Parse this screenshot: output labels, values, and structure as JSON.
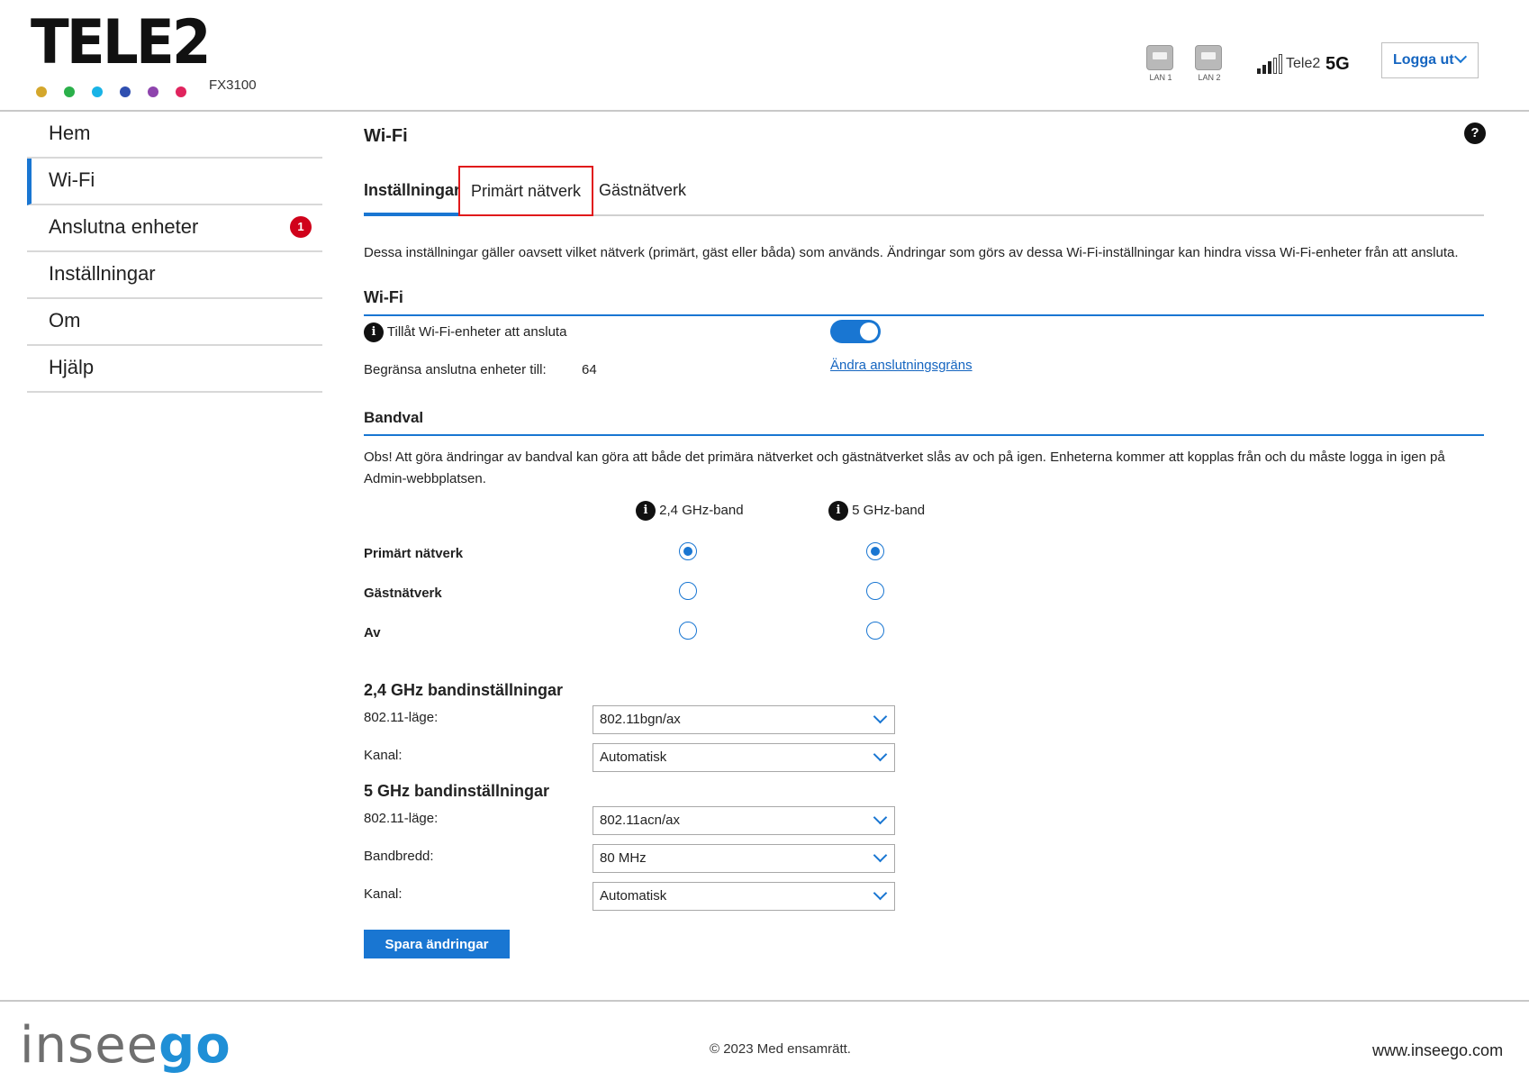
{
  "header": {
    "logo_text": "TELE2",
    "model": "FX3100",
    "dot_colors": [
      "#d4a72c",
      "#2bb04a",
      "#19b3e6",
      "#2f4fb0",
      "#8e44ad",
      "#e0245e"
    ],
    "lan1_label": "LAN 1",
    "lan2_label": "LAN 2",
    "carrier": "Tele2",
    "network_type": "5G",
    "logout_label": "Logga ut"
  },
  "sidebar": {
    "items": [
      {
        "label": "Hem"
      },
      {
        "label": "Wi-Fi"
      },
      {
        "label": "Anslutna enheter",
        "badge": "1"
      },
      {
        "label": "Inställningar"
      },
      {
        "label": "Om"
      },
      {
        "label": "Hjälp"
      }
    ]
  },
  "main": {
    "title": "Wi-Fi",
    "help_icon": "?",
    "tabs": [
      {
        "label": "Inställningar"
      },
      {
        "label": "Primärt nätverk"
      },
      {
        "label": "Gästnätverk"
      }
    ],
    "description": "Dessa inställningar gäller oavsett vilket nätverk (primärt, gäst eller båda) som används. Ändringar som görs av dessa Wi-Fi-inställningar kan hindra vissa Wi-Fi-enheter från att ansluta.",
    "wifi_section": {
      "title": "Wi-Fi",
      "allow_label": "Tillåt Wi-Fi-enheter att ansluta",
      "allow_enabled": true,
      "limit_label": "Begränsa anslutna enheter till:",
      "limit_value": "64",
      "change_limit_link": "Ändra anslutningsgräns"
    },
    "band_section": {
      "title": "Bandval",
      "note": "Obs! Att göra ändringar av bandval kan göra att både det primära nätverket och gästnätverket slås av och på igen. Enheterna kommer att kopplas från och du måste logga in igen på Admin-webbplatsen.",
      "col_24": "2,4 GHz-band",
      "col_5": "5 GHz-band",
      "rows": [
        {
          "label": "Primärt nätverk",
          "band24": true,
          "band5": true
        },
        {
          "label": "Gästnätverk",
          "band24": false,
          "band5": false
        },
        {
          "label": "Av",
          "band24": false,
          "band5": false
        }
      ]
    },
    "band24_settings": {
      "title": "2,4 GHz bandinställningar",
      "mode_label": "802.11-läge:",
      "mode_value": "802.11bgn/ax",
      "channel_label": "Kanal:",
      "channel_value": "Automatisk"
    },
    "band5_settings": {
      "title": "5 GHz bandinställningar",
      "mode_label": "802.11-läge:",
      "mode_value": "802.11acn/ax",
      "bandwidth_label": "Bandbredd:",
      "bandwidth_value": "80 MHz",
      "channel_label": "Kanal:",
      "channel_value": "Automatisk"
    },
    "save_label": "Spara ändringar"
  },
  "footer": {
    "brand_a": "insee",
    "brand_b": "go",
    "copyright": "© 2023 Med ensamrätt.",
    "website": "www.inseego.com"
  },
  "colors": {
    "accent": "#1976d2",
    "highlight": "#e0191b",
    "badge": "#d0021b"
  }
}
